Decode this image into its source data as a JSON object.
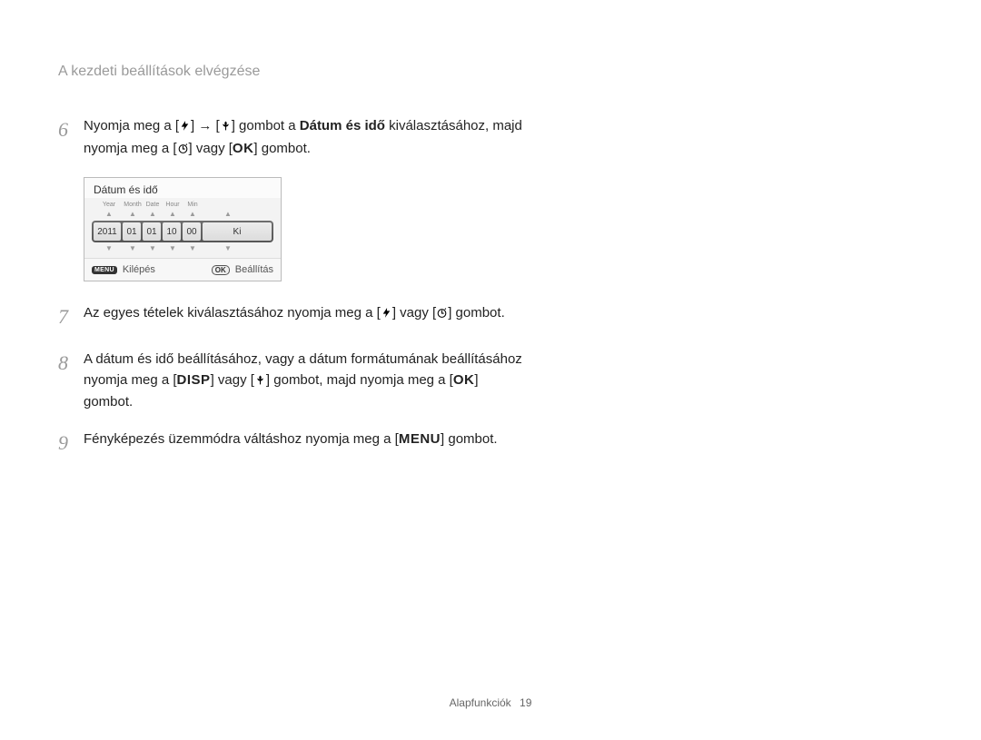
{
  "header": {
    "title": "A kezdeti beállítások elvégzése"
  },
  "step6": {
    "num": "6",
    "t1": "Nyomja meg a [",
    "t2": "] → [",
    "t3": "] gombot a ",
    "bold": "Dátum és idő",
    "t4": " kiválasztásához, majd nyomja meg a [",
    "t5": "] vagy [",
    "t6": "] gombot.",
    "ok": "OK"
  },
  "lcd": {
    "title": "Dátum és idő",
    "labels": {
      "year": "Year",
      "month": "Month",
      "date": "Date",
      "hour": "Hour",
      "min": "Min"
    },
    "values": {
      "year": "2011",
      "month": "01",
      "date": "01",
      "hour": "10",
      "min": "00",
      "off": "Ki"
    },
    "footer": {
      "menu": "MENU",
      "exit": "Kilépés",
      "ok": "OK",
      "set": "Beállítás"
    }
  },
  "step7": {
    "num": "7",
    "t1": "Az egyes tételek kiválasztásához nyomja meg a [",
    "t2": "] vagy [",
    "t3": "] gombot."
  },
  "step8": {
    "num": "8",
    "t1": "A dátum és idő beállításához, vagy a dátum formátumának beállításához nyomja meg a [",
    "disp": "DISP",
    "t2": "] vagy [",
    "t3": "] gombot, majd nyomja meg a [",
    "ok": "OK",
    "t4": "] gombot."
  },
  "step9": {
    "num": "9",
    "t1": "Fényképezés üzemmódra váltáshoz nyomja meg a [",
    "menu": "MENU",
    "t2": "]  gombot."
  },
  "footer": {
    "section": "Alapfunkciók",
    "page": "19"
  }
}
